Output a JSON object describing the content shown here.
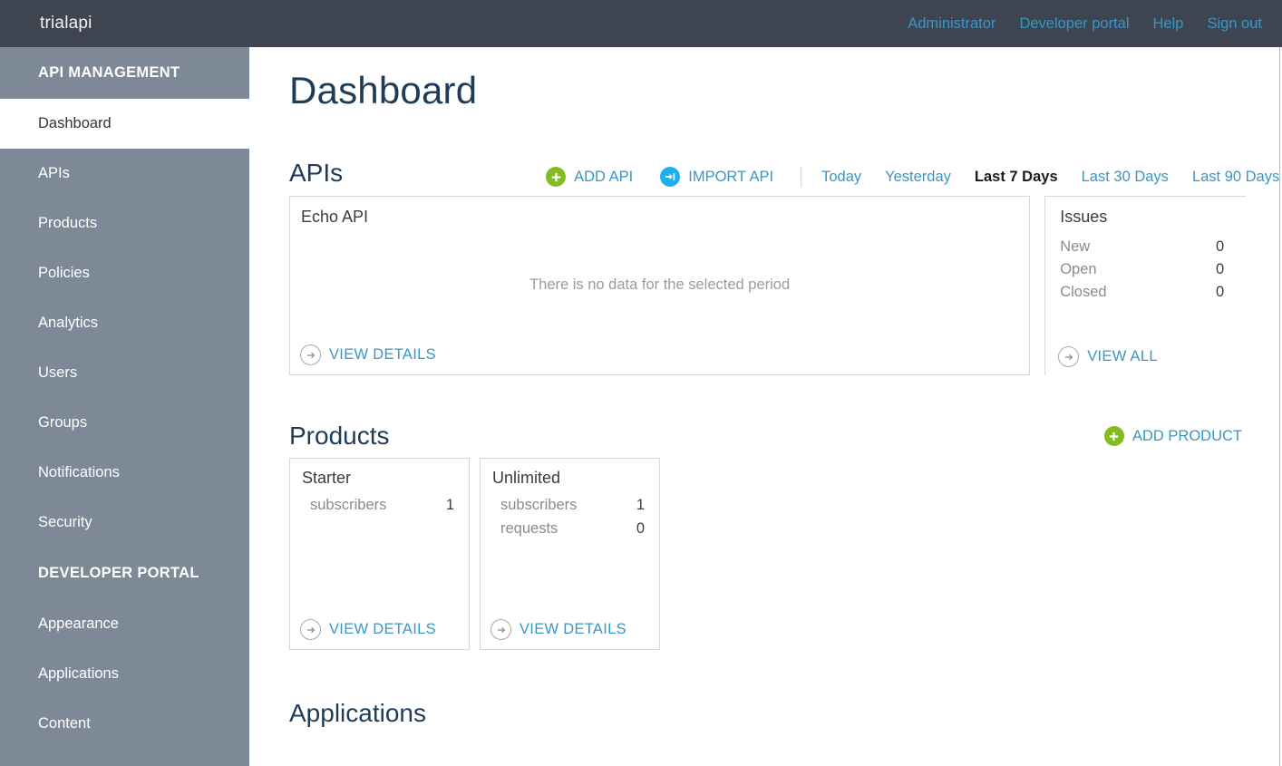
{
  "topbar": {
    "brand": "trialapi",
    "nav": [
      {
        "label": "Administrator",
        "name": "administrator"
      },
      {
        "label": "Developer portal",
        "name": "developer-portal"
      },
      {
        "label": "Help",
        "name": "help"
      },
      {
        "label": "Sign out",
        "name": "sign-out"
      }
    ]
  },
  "sidebar": {
    "sections": [
      {
        "heading": "API MANAGEMENT",
        "items": [
          {
            "label": "Dashboard",
            "active": true
          },
          {
            "label": "APIs",
            "active": false
          },
          {
            "label": "Products",
            "active": false
          },
          {
            "label": "Policies",
            "active": false
          },
          {
            "label": "Analytics",
            "active": false
          },
          {
            "label": "Users",
            "active": false
          },
          {
            "label": "Groups",
            "active": false
          },
          {
            "label": "Notifications",
            "active": false
          },
          {
            "label": "Security",
            "active": false
          }
        ]
      },
      {
        "heading": "DEVELOPER PORTAL",
        "items": [
          {
            "label": "Appearance",
            "active": false
          },
          {
            "label": "Applications",
            "active": false
          },
          {
            "label": "Content",
            "active": false
          }
        ]
      }
    ]
  },
  "page": {
    "title": "Dashboard"
  },
  "apis": {
    "title": "APIs",
    "add_label": "ADD API",
    "import_label": "IMPORT API",
    "ranges": [
      {
        "label": "Today",
        "selected": false
      },
      {
        "label": "Yesterday",
        "selected": false
      },
      {
        "label": "Last 7 Days",
        "selected": true
      },
      {
        "label": "Last 30 Days",
        "selected": false
      },
      {
        "label": "Last 90 Days",
        "selected": false
      }
    ],
    "card": {
      "name": "Echo API",
      "empty_message": "There is no data for the selected period",
      "view_details_label": "VIEW DETAILS"
    }
  },
  "issues": {
    "title": "Issues",
    "rows": [
      {
        "label": "New",
        "value": "0"
      },
      {
        "label": "Open",
        "value": "0"
      },
      {
        "label": "Closed",
        "value": "0"
      }
    ],
    "view_all_label": "VIEW ALL"
  },
  "products": {
    "title": "Products",
    "add_label": "ADD PRODUCT",
    "cards": [
      {
        "name": "Starter",
        "stats": [
          {
            "label": "subscribers",
            "value": "1"
          }
        ],
        "view_details_label": "VIEW DETAILS"
      },
      {
        "name": "Unlimited",
        "stats": [
          {
            "label": "subscribers",
            "value": "1"
          },
          {
            "label": "requests",
            "value": "0"
          }
        ],
        "view_details_label": "VIEW DETAILS"
      }
    ]
  },
  "applications": {
    "title": "Applications"
  },
  "colors": {
    "topbar_bg": "#3e4450",
    "sidebar_bg": "#7d8997",
    "link": "#3a96c4",
    "heading": "#1f3b57",
    "add_icon_green": "#82bc20",
    "import_icon_blue": "#1eb0ed",
    "card_border": "#cfd9df"
  }
}
